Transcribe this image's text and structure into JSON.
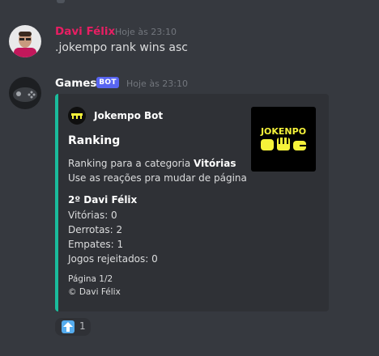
{
  "messages": [
    {
      "author": "Davi Félix",
      "author_color": "#e91e63",
      "timestamp": "Hoje às 23:10",
      "content": ".jokempo rank wins asc",
      "avatar_icon": "user-photo-avatar"
    },
    {
      "author": "Games",
      "author_color": "#ffffff",
      "bot_tag": "BOT",
      "timestamp": "Hoje às 23:10",
      "avatar_icon": "gamepad-avatar",
      "embed": {
        "accent_color": "#1abc9c",
        "author_name": "Jokempo Bot",
        "author_icon": "jokempo-logo-icon",
        "title": "Ranking",
        "description_prefix": "Ranking para a categoria ",
        "description_bold": "Vitórias",
        "description_line2": "Use as reações pra mudar de página",
        "field": {
          "name": "2º Davi Félix",
          "lines": [
            "Vitórias: 0",
            "Derrotas: 2",
            "Empates: 1",
            "Jogos rejeitados: 0"
          ]
        },
        "footer_lines": [
          "Página 1/2",
          "© Davi Félix"
        ],
        "thumbnail_text": "JOKENPO"
      },
      "reactions": [
        {
          "emoji": "arrow-up-emoji",
          "count": "1"
        }
      ]
    }
  ]
}
